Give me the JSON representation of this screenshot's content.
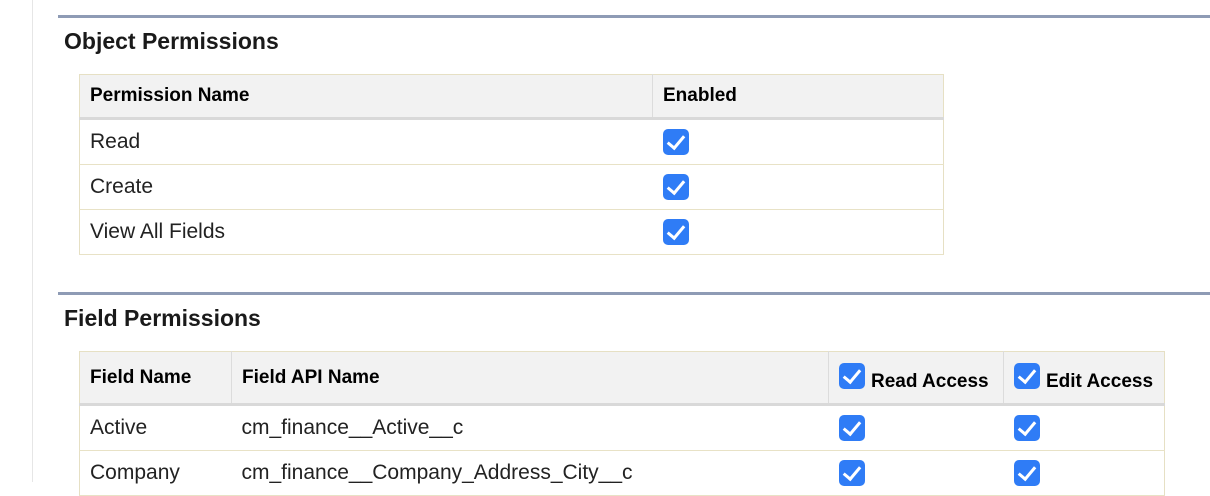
{
  "object_permissions": {
    "title": "Object Permissions",
    "columns": [
      "Permission Name",
      "Enabled"
    ],
    "rows": [
      {
        "name": "Read",
        "enabled": true
      },
      {
        "name": "Create",
        "enabled": true
      },
      {
        "name": "View All Fields",
        "enabled": true
      }
    ]
  },
  "field_permissions": {
    "title": "Field Permissions",
    "columns": [
      "Field Name",
      "Field API Name",
      "Read Access",
      "Edit Access"
    ],
    "header_checks": {
      "read_access": true,
      "edit_access": true
    },
    "rows": [
      {
        "field_name": "Active",
        "api_name": "cm_finance__Active__c",
        "read": true,
        "edit": true
      },
      {
        "field_name": "Company",
        "api_name": "cm_finance__Company_Address_City__c",
        "read": true,
        "edit": true
      }
    ]
  },
  "colors": {
    "accent": "#2f7cf6",
    "section_rule": "#8e9bb5",
    "header_bg": "#f2f2f2"
  }
}
